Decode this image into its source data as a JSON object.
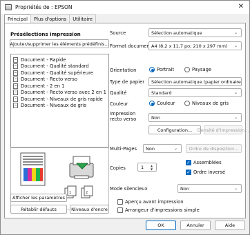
{
  "window": {
    "title": "Propriétés de : EPSON",
    "close_glyph": "✕"
  },
  "tabs": [
    {
      "label": "Principal",
      "active": true
    },
    {
      "label": "Plus d'options",
      "active": false
    },
    {
      "label": "Utilitaire",
      "active": false
    }
  ],
  "presets": {
    "header": "Présélections impression",
    "add_button": "Ajouter/supprimer les éléments prédéfinis...",
    "items": [
      "Document - Rapide",
      "Document - Qualité standard",
      "Document - Qualité supérieure",
      "Document - Recto verso",
      "Document - 2 en 1",
      "Document - Recto verso avec 2 en 1",
      "Document - Niveaux de gris rapide",
      "Document - Niveaux de gris"
    ]
  },
  "left_buttons": {
    "show_settings": "Afficher les paramètres",
    "reset": "Rétablir défauts",
    "ink_levels": "Niveaux d'encre"
  },
  "settings": {
    "source_label": "Source",
    "source_value": "Sélection automatique",
    "format_label": "Format document",
    "format_value": "A4 (8,2 x 11,7 po; 210 x 297 mm)",
    "orientation_label": "Orientation",
    "orientation_portrait": "Portrait",
    "orientation_landscape": "Paysage",
    "paper_label": "Type de papier",
    "paper_value": "Sélection automatique (papier ordinaire)",
    "quality_label": "Qualité",
    "quality_value": "Standard",
    "color_label": "Couleur",
    "color_color": "Couleur",
    "color_gray": "Niveaux de gris",
    "duplex_label": "Impression recto verso",
    "duplex_value": "Non",
    "config_button": "Configuration...",
    "density_button": "Densité d'impression...",
    "multipage_label": "Multi-Pages",
    "multipage_value": "Non",
    "order_button": "Ordre de disposition...",
    "copies_label": "Copies",
    "copies_value": "1",
    "collate_label": "Assemblées",
    "reverse_label": "Ordre inversé",
    "quiet_label": "Mode silencieux",
    "quiet_value": "Non",
    "preview_label": "Aperçu avant impression",
    "simple_label": "Arrangeur d'impressions simple"
  },
  "footer": {
    "ok": "OK",
    "cancel": "Annuler",
    "help": "Aide"
  },
  "colors": {
    "accent": "#0067c0",
    "panel": "#ffffff",
    "chrome": "#f0f0f0"
  }
}
